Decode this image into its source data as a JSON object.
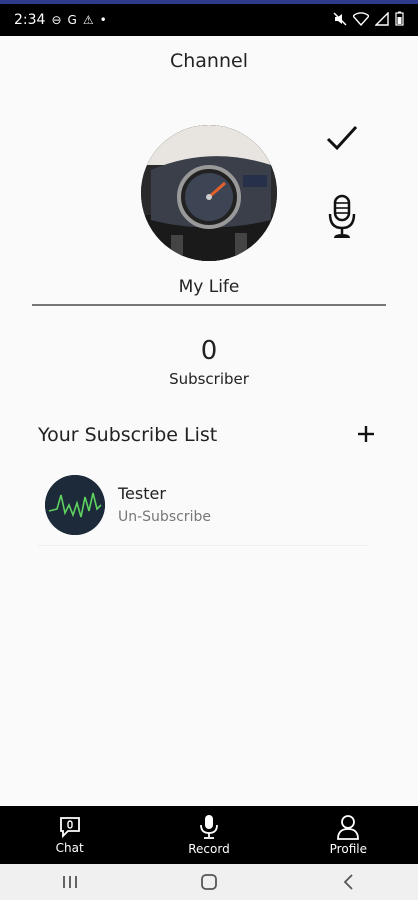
{
  "status_bar": {
    "time": "2:34",
    "left_icons": [
      "circle-icon",
      "g-icon",
      "warning-icon",
      "dot-icon"
    ],
    "right_icons": [
      "mute-icon",
      "wifi-icon",
      "signal-icon",
      "battery-icon"
    ]
  },
  "header": {
    "title": "Channel"
  },
  "profile": {
    "avatar_icon": "speedometer-photo",
    "name_value": "My Life",
    "subscriber_count": "0",
    "subscriber_label": "Subscriber"
  },
  "subscribe_list": {
    "title": "Your Subscribe List",
    "items": [
      {
        "name": "Tester",
        "action": "Un-Subscribe"
      }
    ]
  },
  "bottom_nav": {
    "items": [
      {
        "label": "Chat",
        "icon": "chat-icon"
      },
      {
        "label": "Record",
        "icon": "microphone-icon"
      },
      {
        "label": "Profile",
        "icon": "person-icon"
      }
    ]
  },
  "colors": {
    "accent": "#2e3a8c",
    "nav_bg": "#000000",
    "background": "#fafafa"
  }
}
